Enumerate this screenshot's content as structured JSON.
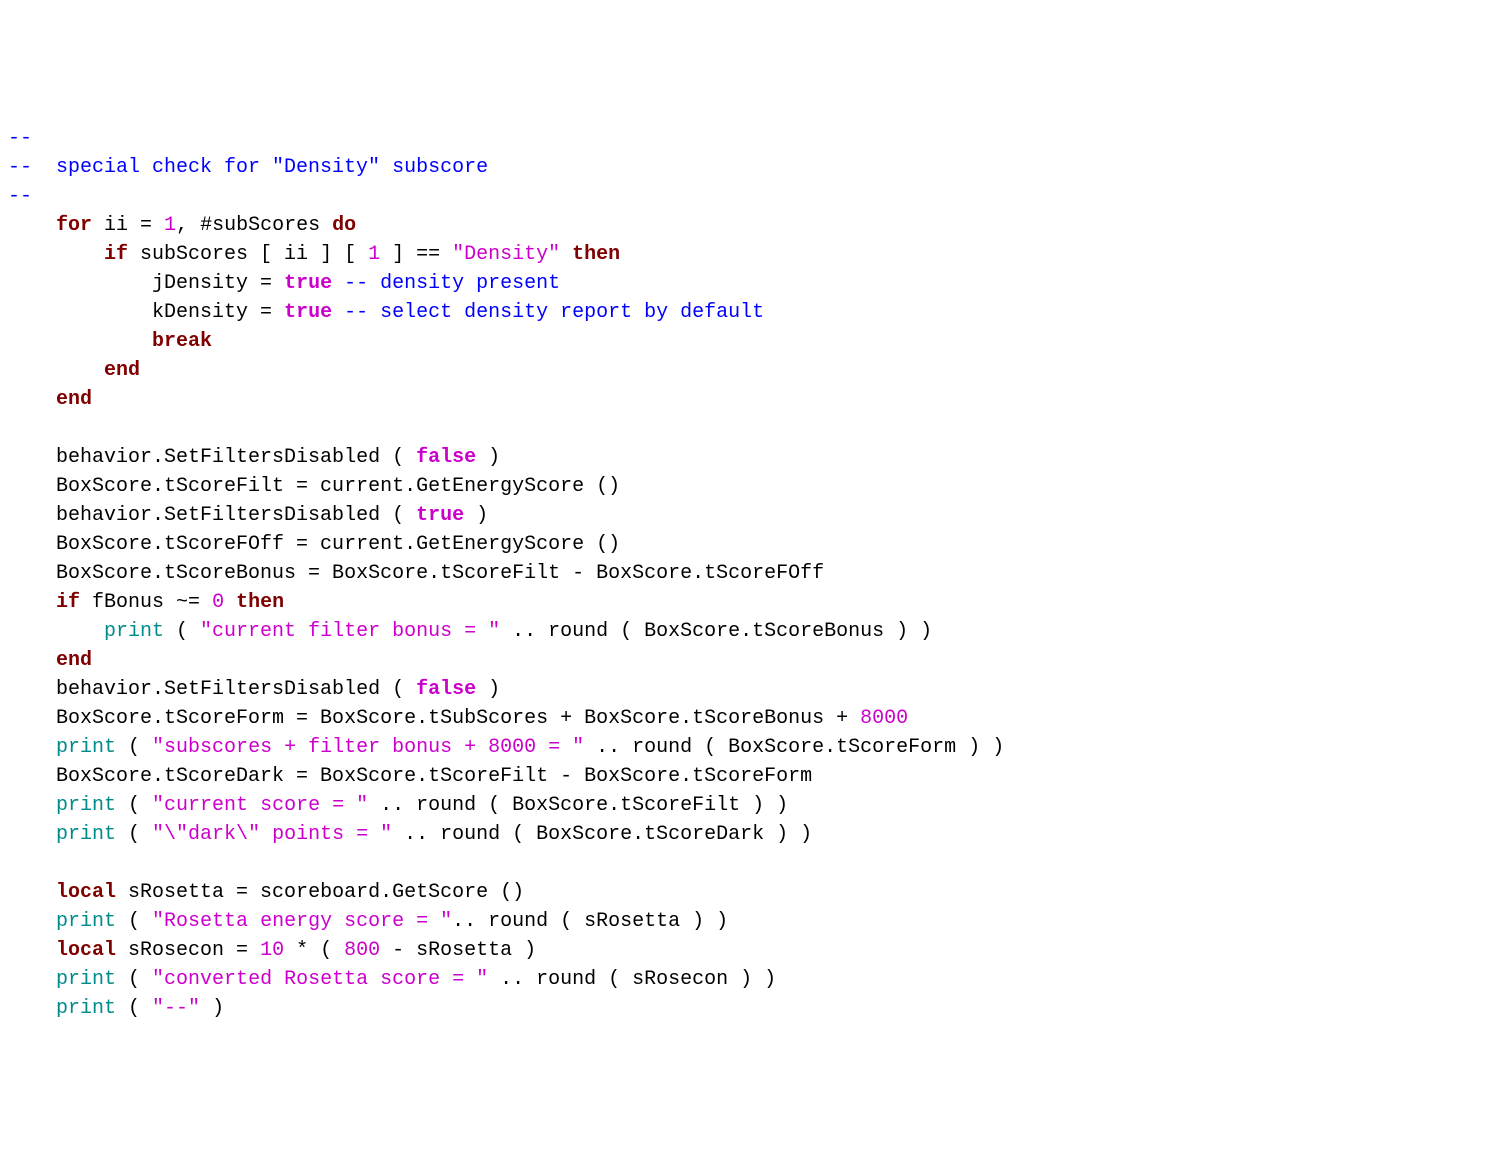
{
  "lines": {
    "l1_1": "--",
    "l2_1": "--  special check for \"Density\" subscore",
    "l3_1": "--",
    "l4_1": "for",
    "l4_2": " ii = ",
    "l4_3": "1",
    "l4_4": ", #subScores ",
    "l4_5": "do",
    "l5_1": "if",
    "l5_2": " subScores [ ii ] [ ",
    "l5_3": "1",
    "l5_4": " ] == ",
    "l5_5": "\"Density\"",
    "l5_6": " ",
    "l5_7": "then",
    "l6_1": "jDensity = ",
    "l6_2": "true",
    "l6_3": " ",
    "l6_4": "-- density present",
    "l7_1": "kDensity = ",
    "l7_2": "true",
    "l7_3": " ",
    "l7_4": "-- select density report by default",
    "l8_1": "break",
    "l9_1": "end",
    "l10_1": "end",
    "l11_1": "behavior.SetFiltersDisabled ( ",
    "l11_2": "false",
    "l11_3": " )",
    "l12_1": "BoxScore.tScoreFilt = current.GetEnergyScore ()",
    "l13_1": "behavior.SetFiltersDisabled ( ",
    "l13_2": "true",
    "l13_3": " )",
    "l14_1": "BoxScore.tScoreFOff = current.GetEnergyScore ()",
    "l15_1": "BoxScore.tScoreBonus = BoxScore.tScoreFilt - BoxScore.tScoreFOff",
    "l16_1": "if",
    "l16_2": " fBonus ~= ",
    "l16_3": "0",
    "l16_4": " ",
    "l16_5": "then",
    "l17_1": "print",
    "l17_2": " ( ",
    "l17_3": "\"current filter bonus = \"",
    "l17_4": " .. round ( BoxScore.tScoreBonus ) )",
    "l18_1": "end",
    "l19_1": "behavior.SetFiltersDisabled ( ",
    "l19_2": "false",
    "l19_3": " )",
    "l20_1": "BoxScore.tScoreForm = BoxScore.tSubScores + BoxScore.tScoreBonus + ",
    "l20_2": "8000",
    "l21_1": "print",
    "l21_2": " ( ",
    "l21_3": "\"subscores + filter bonus + 8000 = \"",
    "l21_4": " .. round ( BoxScore.tScoreForm ) )",
    "l22_1": "BoxScore.tScoreDark = BoxScore.tScoreFilt - BoxScore.tScoreForm",
    "l23_1": "print",
    "l23_2": " ( ",
    "l23_3": "\"current score = \"",
    "l23_4": " .. round ( BoxScore.tScoreFilt ) )",
    "l24_1": "print",
    "l24_2": " ( ",
    "l24_3": "\"\\\"dark\\\" points = \"",
    "l24_4": " .. round ( BoxScore.tScoreDark ) )",
    "l25_1": "local",
    "l25_2": " sRosetta = scoreboard.GetScore ()",
    "l26_1": "print",
    "l26_2": " ( ",
    "l26_3": "\"Rosetta energy score = \"",
    "l26_4": ".. round ( sRosetta ) )",
    "l27_1": "local",
    "l27_2": " sRosecon = ",
    "l27_3": "10",
    "l27_4": " * ( ",
    "l27_5": "800",
    "l27_6": " - sRosetta )",
    "l28_1": "print",
    "l28_2": " ( ",
    "l28_3": "\"converted Rosetta score = \"",
    "l28_4": " .. round ( sRosecon ) )",
    "l29_1": "print",
    "l29_2": " ( ",
    "l29_3": "\"--\"",
    "l29_4": " )"
  }
}
